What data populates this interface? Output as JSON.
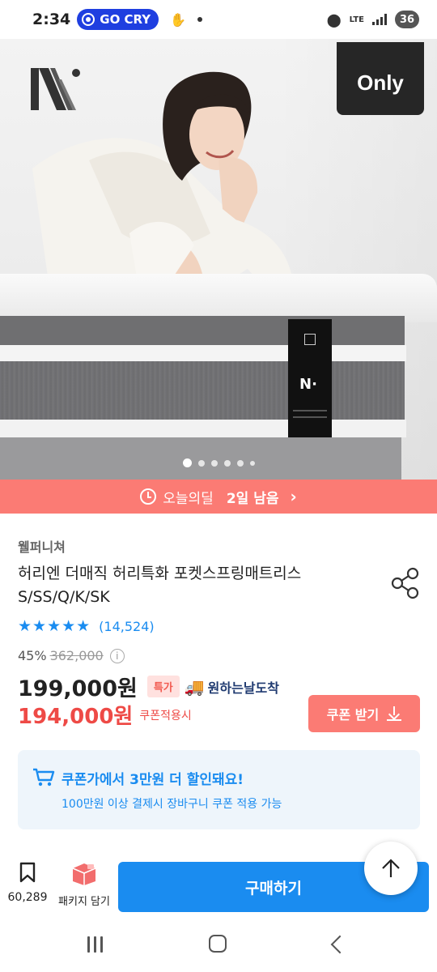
{
  "status_bar": {
    "time": "2:34",
    "go_pill_label": "GO CRY",
    "network": "LTE",
    "battery": "36"
  },
  "hero": {
    "badge": "Only",
    "slide_total": 6,
    "slide_active": 1
  },
  "deal_banner": {
    "label": "오늘의딜",
    "remaining": "2일 남음",
    "chevron": "›"
  },
  "product": {
    "brand": "웰퍼니쳐",
    "title": "허리엔 더매직 허리특화 포켓스프링매트리스 S/SS/Q/K/SK",
    "stars": "★★★★★",
    "review_count": "(14,524)",
    "discount_pct": "45%",
    "original_price": "362,000",
    "price": "199,000원",
    "special_badge": "특가",
    "delivery_label": "원하는날도착",
    "coupon_price": "194,000원",
    "coupon_note": "쿠폰적용시",
    "coupon_button": "쿠폰 받기"
  },
  "coupon_info": {
    "title": "쿠폰가에서 3만원 더 할인돼요!",
    "subtitle": "100만원 이상 결제시 장바구니 쿠폰 적용 가능"
  },
  "bottom_bar": {
    "wish_count": "60,289",
    "package_label": "패키지 담기",
    "buy_button": "구매하기"
  },
  "colors": {
    "accent_blue": "#1a8cf0",
    "deal_coral": "#fb7b74",
    "coupon_red": "#ee4a46"
  }
}
